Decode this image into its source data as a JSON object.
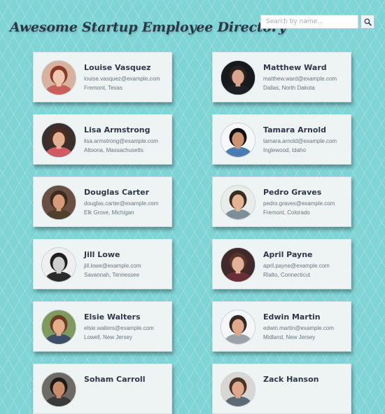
{
  "header": {
    "title": "Awesome Startup Employee Directory",
    "search_placeholder": "Search by name...",
    "search_value": "",
    "search_icon": "magnifier-icon"
  },
  "employees": [
    {
      "name": "Louise Vasquez",
      "email": "louise.vasquez@example.com",
      "location": "Fremont, Texas",
      "avatar_bg": "#d7b39f",
      "avatar_hair": "#8a3a24",
      "avatar_skin": "#f0c8b2",
      "avatar_shirt": "#c95f5a"
    },
    {
      "name": "Matthew Ward",
      "email": "matthew.ward@example.com",
      "location": "Dallas, North Dakota",
      "avatar_bg": "#171a1d",
      "avatar_hair": "#2a2220",
      "avatar_skin": "#dba48d",
      "avatar_shirt": "#1c1f24"
    },
    {
      "name": "Lisa Armstrong",
      "email": "lisa.armstrong@example.com",
      "location": "Altoona, Massachusetts",
      "avatar_bg": "#3b2f2c",
      "avatar_hair": "#4e2b1e",
      "avatar_skin": "#e3b091",
      "avatar_shirt": "#d25a62"
    },
    {
      "name": "Tamara Arnold",
      "email": "tamara.arnold@example.com",
      "location": "Inglewood, Idaho",
      "avatar_bg": "#f5f7f8",
      "avatar_hair": "#111111",
      "avatar_skin": "#cc9472",
      "avatar_shirt": "#4b7bb5"
    },
    {
      "name": "Douglas Carter",
      "email": "douglas.carter@example.com",
      "location": "Elk Grove, Michigan",
      "avatar_bg": "#6a5042",
      "avatar_hair": "#3b2a20",
      "avatar_skin": "#d79b78",
      "avatar_shirt": "#50412f"
    },
    {
      "name": "Pedro Graves",
      "email": "pedro.graves@example.com",
      "location": "Fremont, Colorado",
      "avatar_bg": "#e8ede9",
      "avatar_hair": "#3a2b21",
      "avatar_skin": "#e5b292",
      "avatar_shirt": "#7a8f9a"
    },
    {
      "name": "Jill Lowe",
      "email": "jill.lowe@example.com",
      "location": "Savannah, Tennessee",
      "avatar_bg": "#efefef",
      "avatar_hair": "#1e1e1e",
      "avatar_skin": "#cfcfcf",
      "avatar_shirt": "#2b2b2b"
    },
    {
      "name": "April Payne",
      "email": "april.payne@example.com",
      "location": "Rialto, Connecticut",
      "avatar_bg": "#40292b",
      "avatar_hair": "#5a3428",
      "avatar_skin": "#e2b197",
      "avatar_shirt": "#6b2f3a"
    },
    {
      "name": "Elsie Walters",
      "email": "elsie.walters@example.com",
      "location": "Lowell, New Jersey",
      "avatar_bg": "#7e9a5e",
      "avatar_hair": "#6b3c22",
      "avatar_skin": "#e4ae8c",
      "avatar_shirt": "#3d4f67"
    },
    {
      "name": "Edwin Martin",
      "email": "edwin.martin@example.com",
      "location": "Midland, New Jersey",
      "avatar_bg": "#f4f6f7",
      "avatar_hair": "#2f2824",
      "avatar_skin": "#e0a98c",
      "avatar_shirt": "#9aa3aa"
    },
    {
      "name": "Soham Carroll",
      "email": "",
      "location": "",
      "avatar_bg": "#6e6a66",
      "avatar_hair": "#1e1a18",
      "avatar_skin": "#c98d6c",
      "avatar_shirt": "#3a3a3a"
    },
    {
      "name": "Zack Hanson",
      "email": "",
      "location": "",
      "avatar_bg": "#d9d7d3",
      "avatar_hair": "#4a3426",
      "avatar_skin": "#dfa88a",
      "avatar_shirt": "#5d6973"
    }
  ]
}
